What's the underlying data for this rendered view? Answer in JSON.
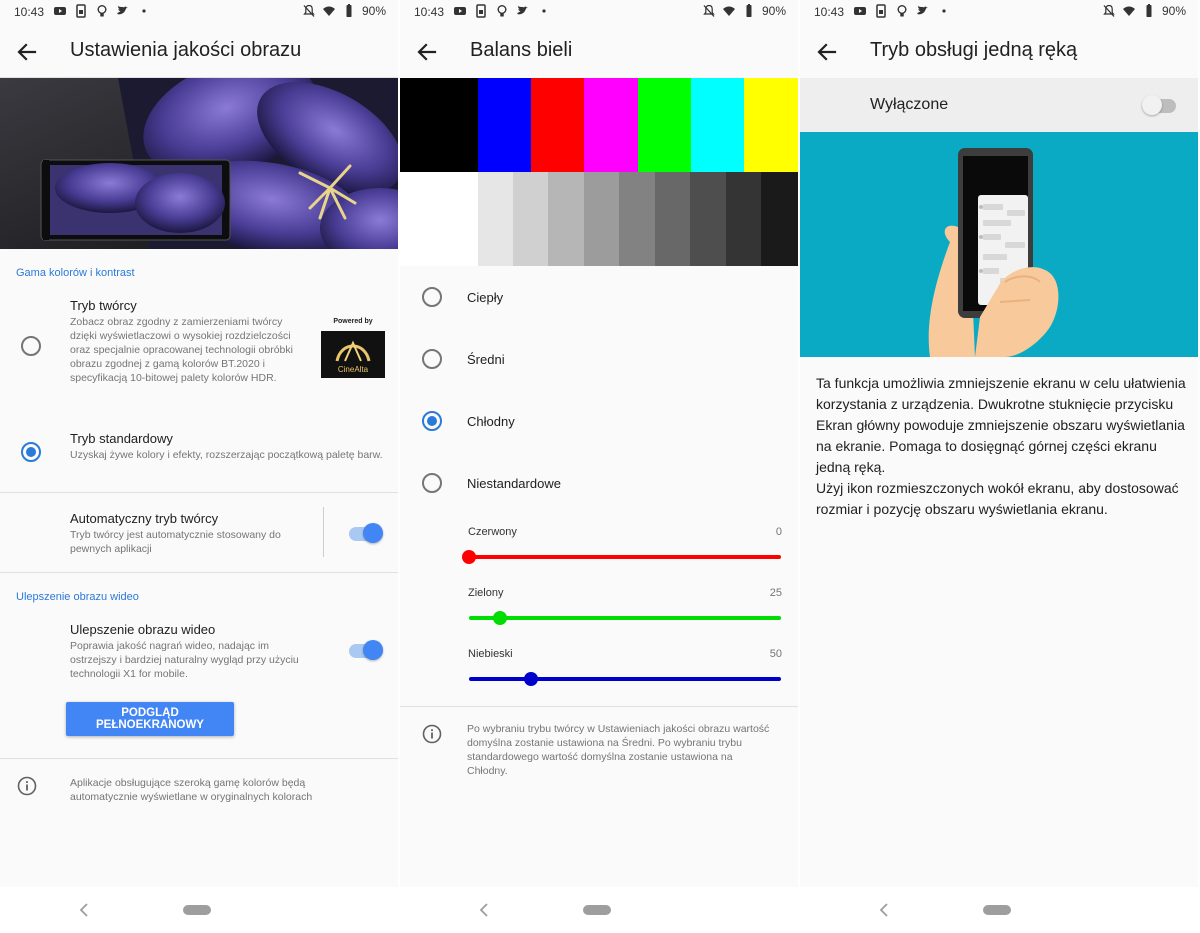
{
  "status": {
    "time": "10:43",
    "battery": "90%"
  },
  "panel1": {
    "title": "Ustawienia jakości obrazu",
    "section1": "Gama kolorów i kontrast",
    "creator": {
      "title": "Tryb twórcy",
      "desc": "Zobacz obraz zgodny z zamierzeniami twórcy dzięki wyświetlaczowi o wysokiej rozdzielczości oraz specjalnie opracowanej technologii obróbki obrazu zgodnej z gamą kolorów BT.2020 i specyfikacją 10-bitowej palety kolorów HDR.",
      "logo_powered": "Powered by",
      "logo_name": "CineAlta"
    },
    "standard": {
      "title": "Tryb standardowy",
      "desc": "Uzyskaj żywe kolory i efekty, rozszerzając początkową paletę barw."
    },
    "auto": {
      "title": "Automatyczny tryb twórcy",
      "desc": "Tryb twórcy jest automatycznie stosowany do pewnych aplikacji"
    },
    "section2": "Ulepszenie obrazu wideo",
    "video": {
      "title": "Ulepszenie obrazu wideo",
      "desc": "Poprawia jakość nagrań wideo, nadając im ostrzejszy i bardziej naturalny wygląd przy użyciu technologii X1 for mobile."
    },
    "preview_button": "PODGLĄD PEŁNOEKRANOWY",
    "info": "Aplikacje obsługujące szeroką gamę kolorów będą automatycznie wyświetlane w oryginalnych kolorach"
  },
  "panel2": {
    "title": "Balans bieli",
    "color_bars_top": [
      "#000000",
      "#0000ff",
      "#ff0000",
      "#ff00ff",
      "#00ff00",
      "#00ffff",
      "#ffff00"
    ],
    "color_bars_bottom": [
      "#ffffff",
      "#e6e6e6",
      "#d0d0d0",
      "#b6b6b6",
      "#9c9c9c",
      "#828282",
      "#686868",
      "#4e4e4e",
      "#343434",
      "#1a1a1a"
    ],
    "options": [
      "Ciepły",
      "Średni",
      "Chłodny",
      "Niestandardowe"
    ],
    "selected": "Chłodny",
    "sliders": [
      {
        "label": "Czerwony",
        "value": "0",
        "color": "#ff0000",
        "fraction": 0.0
      },
      {
        "label": "Zielony",
        "value": "25",
        "color": "#00dd00",
        "fraction": 0.1
      },
      {
        "label": "Niebieski",
        "value": "50",
        "color": "#0000cc",
        "fraction": 0.2
      }
    ],
    "info": "Po wybraniu trybu twórcy w Ustawieniach jakości obrazu wartość domyślna zostanie ustawiona na Średni. Po wybraniu trybu standardowego wartość domyślna zostanie ustawiona na Chłodny."
  },
  "panel3": {
    "title": "Tryb obsługi jedną ręką",
    "toggle_label": "Wyłączone",
    "description_1": "Ta funkcja umożliwia zmniejszenie ekranu w celu ułatwienia korzystania z urządzenia. Dwukrotne stuknięcie przycisku Ekran główny powoduje zmniejszenie obszaru wyświetlania na ekranie. Pomaga to dosięgnąć górnej części ekranu jedną ręką.",
    "description_2": "Użyj ikon rozmieszczonych wokół ekranu, aby dostosować rozmiar i pozycję obszaru wyświetlania ekranu."
  },
  "colors": {
    "accent": "#4285f4",
    "section_header": "#2a7ad8",
    "illustration_bg": "#0aa9c4"
  }
}
